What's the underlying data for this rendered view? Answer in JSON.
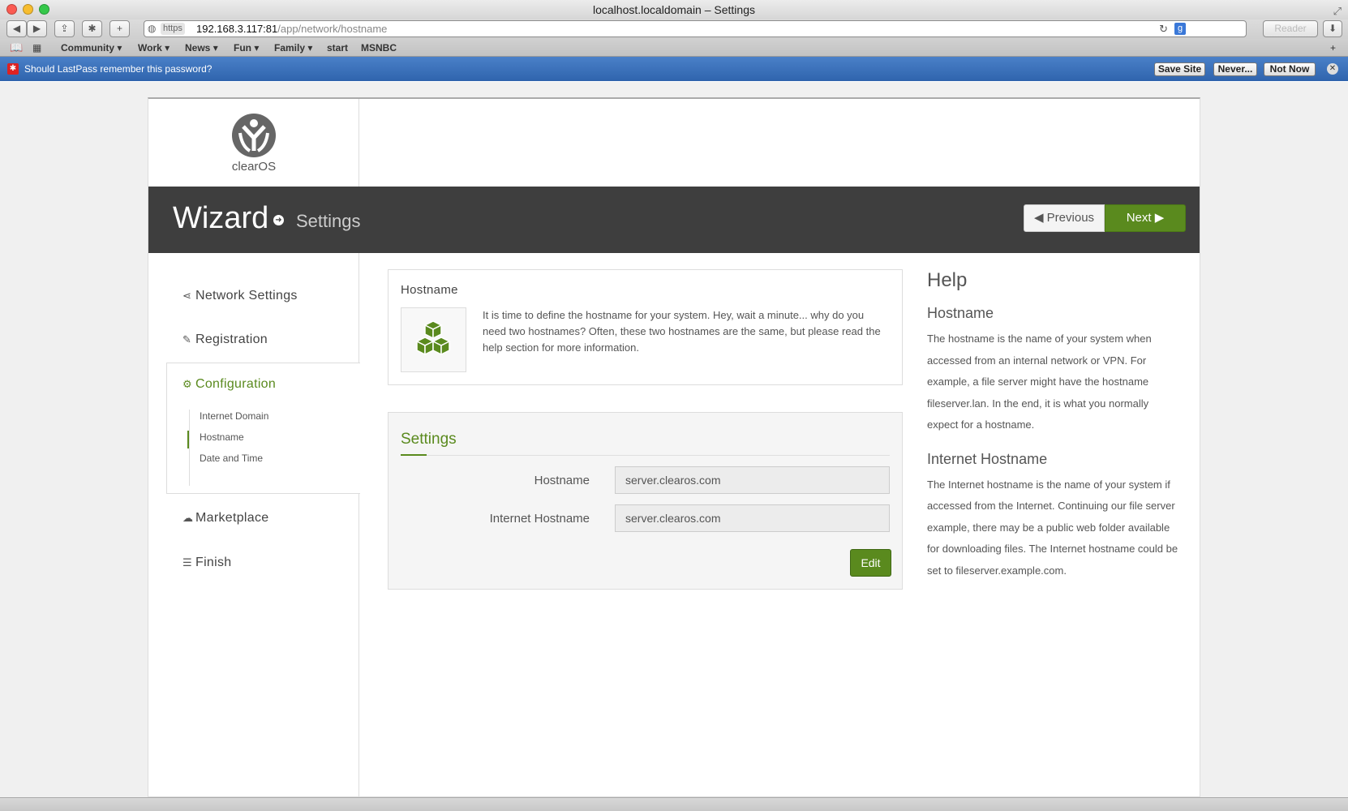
{
  "window": {
    "title": "localhost.localdomain – Settings"
  },
  "browser": {
    "https_label": "https",
    "url_host": "192.168.3.117:81",
    "url_path": "/app/network/hostname",
    "reader_label": "Reader",
    "bookmarks": [
      "Community",
      "Work",
      "News",
      "Fun",
      "Family",
      "start",
      "MSNBC"
    ]
  },
  "lastpass": {
    "message": "Should LastPass remember this password?",
    "save_site": "Save Site",
    "never": "Never...",
    "not_now": "Not Now"
  },
  "logo": {
    "text": "clearOS"
  },
  "header": {
    "title": "Wizard",
    "subtitle": "Settings",
    "prev_label": "Previous",
    "next_label": "Next"
  },
  "sidebar": {
    "items": [
      {
        "label": "Network Settings",
        "icon": "share-icon"
      },
      {
        "label": "Registration",
        "icon": "pencil-icon"
      },
      {
        "label": "Configuration",
        "icon": "gears-icon"
      },
      {
        "label": "Marketplace",
        "icon": "cloud-download-icon"
      },
      {
        "label": "Finish",
        "icon": "list-icon"
      }
    ],
    "sub_items": [
      "Internet Domain",
      "Hostname",
      "Date and Time"
    ]
  },
  "intro_card": {
    "title": "Hostname",
    "description": "It is time to define the hostname for your system. Hey, wait a minute... why do you need two hostnames? Often, these two hostnames are the same, but please read the help section for more information."
  },
  "settings_card": {
    "title": "Settings",
    "hostname_label": "Hostname",
    "hostname_value": "server.clearos.com",
    "internet_hostname_label": "Internet Hostname",
    "internet_hostname_value": "server.clearos.com",
    "edit_label": "Edit"
  },
  "help": {
    "title": "Help",
    "sections": [
      {
        "heading": "Hostname",
        "text": "The hostname is the name of your system when accessed from an internal network or VPN. For example, a file server might have the hostname fileserver.lan. In the end, it is what you normally expect for a hostname."
      },
      {
        "heading": "Internet Hostname",
        "text": "The Internet hostname is the name of your system if accessed from the Internet. Continuing our file server example, there may be a public web folder available for downloading files. The Internet hostname could be set to fileserver.example.com."
      }
    ]
  },
  "colors": {
    "accent": "#5a8a1e",
    "header_bg": "#3e3e3e",
    "lastpass_bar": "#3a6fb8"
  }
}
